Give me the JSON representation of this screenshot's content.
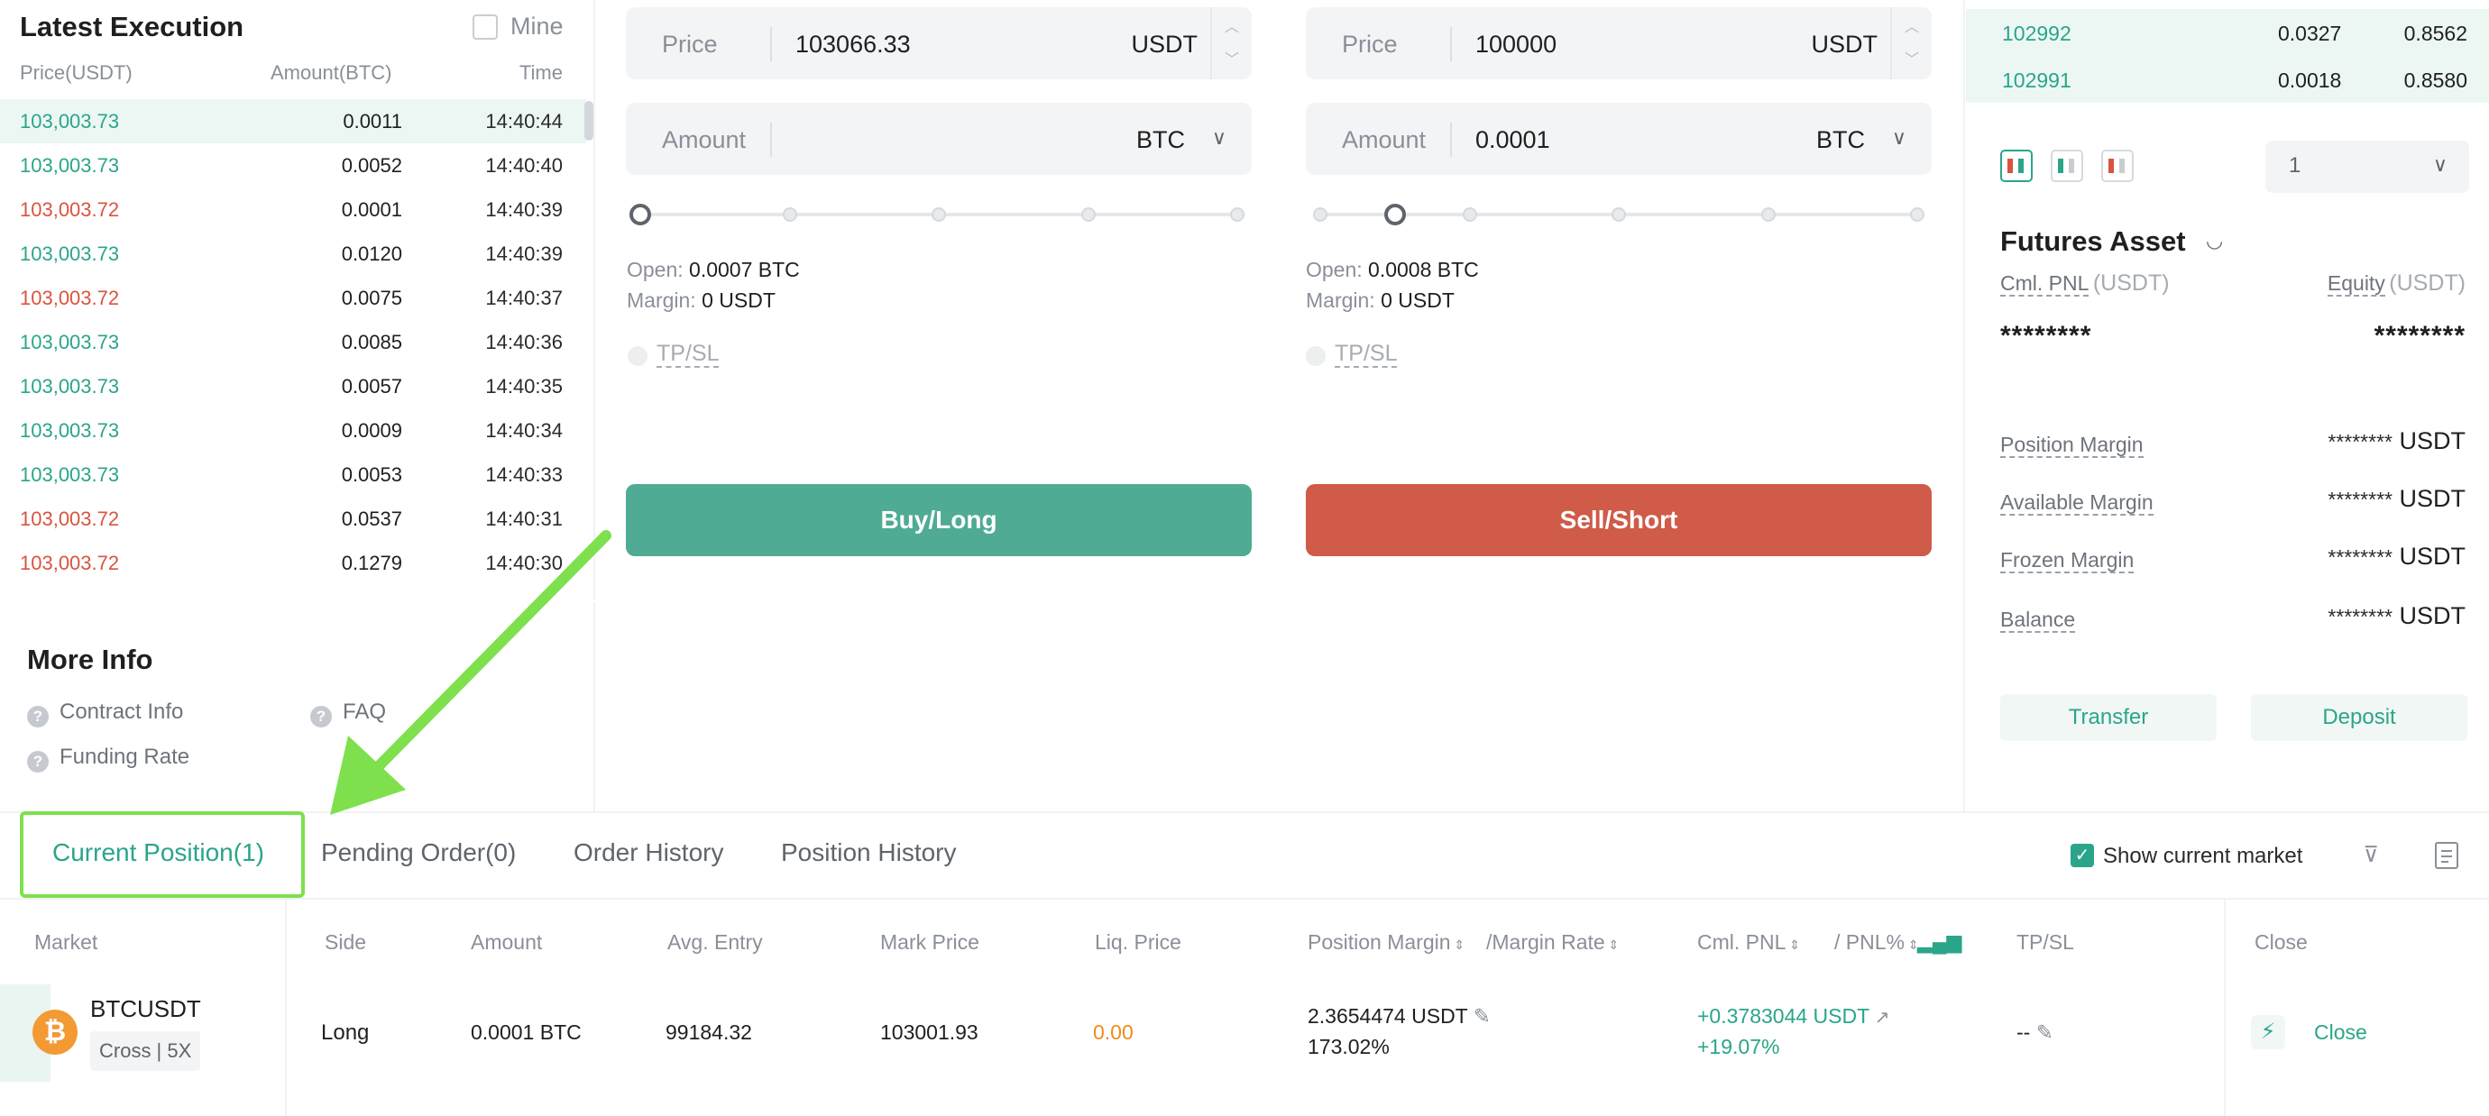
{
  "latest_execution": {
    "title": "Latest Execution",
    "mine_label": "Mine",
    "columns": {
      "price": "Price(USDT)",
      "amount": "Amount(BTC)",
      "time": "Time"
    },
    "rows": [
      {
        "price": "103,003.73",
        "amount": "0.0011",
        "time": "14:40:44",
        "side": "buy"
      },
      {
        "price": "103,003.73",
        "amount": "0.0052",
        "time": "14:40:40",
        "side": "buy"
      },
      {
        "price": "103,003.72",
        "amount": "0.0001",
        "time": "14:40:39",
        "side": "sell"
      },
      {
        "price": "103,003.73",
        "amount": "0.0120",
        "time": "14:40:39",
        "side": "buy"
      },
      {
        "price": "103,003.72",
        "amount": "0.0075",
        "time": "14:40:37",
        "side": "sell"
      },
      {
        "price": "103,003.73",
        "amount": "0.0085",
        "time": "14:40:36",
        "side": "buy"
      },
      {
        "price": "103,003.73",
        "amount": "0.0057",
        "time": "14:40:35",
        "side": "buy"
      },
      {
        "price": "103,003.73",
        "amount": "0.0009",
        "time": "14:40:34",
        "side": "buy"
      },
      {
        "price": "103,003.73",
        "amount": "0.0053",
        "time": "14:40:33",
        "side": "buy"
      },
      {
        "price": "103,003.72",
        "amount": "0.0537",
        "time": "14:40:31",
        "side": "sell"
      },
      {
        "price": "103,003.72",
        "amount": "0.1279",
        "time": "14:40:30",
        "side": "sell"
      }
    ]
  },
  "more_info": {
    "title": "More Info",
    "contract_info": "Contract Info",
    "faq": "FAQ",
    "funding_rate": "Funding Rate"
  },
  "buy_form": {
    "price_label": "Price",
    "price_value": "103066.33",
    "price_unit": "USDT",
    "amount_label": "Amount",
    "amount_value": "",
    "amount_unit": "BTC",
    "open_label": "Open:",
    "open_value": "0.0007 BTC",
    "margin_label": "Margin:",
    "margin_value": "0 USDT",
    "tpsl_label": "TP/SL",
    "button_label": "Buy/Long",
    "slider_level": 0
  },
  "sell_form": {
    "price_label": "Price",
    "price_value": "100000",
    "price_unit": "USDT",
    "amount_label": "Amount",
    "amount_value": "0.0001",
    "amount_unit": "BTC",
    "open_label": "Open:",
    "open_value": "0.0008 BTC",
    "margin_label": "Margin:",
    "margin_value": "0 USDT",
    "tpsl_label": "TP/SL",
    "button_label": "Sell/Short",
    "slider_level": 0.125
  },
  "order_book": {
    "rows": [
      {
        "price": "102992",
        "amount": "0.0327",
        "total": "0.8562"
      },
      {
        "price": "102991",
        "amount": "0.0018",
        "total": "0.8580"
      }
    ],
    "depth_value": "1"
  },
  "futures_asset": {
    "title": "Futures Asset",
    "cml_pnl_label": "Cml. PNL",
    "cml_pnl_unit": "(USDT)",
    "equity_label": "Equity",
    "equity_unit": "(USDT)",
    "cml_pnl_value": "********",
    "equity_value": "********",
    "rows": [
      {
        "label": "Position Margin",
        "value": "********",
        "unit": "USDT"
      },
      {
        "label": "Available Margin",
        "value": "********",
        "unit": "USDT"
      },
      {
        "label": "Frozen Margin",
        "value": "********",
        "unit": "USDT"
      },
      {
        "label": "Balance",
        "value": "********",
        "unit": "USDT"
      }
    ],
    "transfer_label": "Transfer",
    "deposit_label": "Deposit"
  },
  "tabs": {
    "current_position": "Current Position(1)",
    "pending_order": "Pending Order(0)",
    "order_history": "Order History",
    "position_history": "Position History",
    "show_current_market": "Show current market"
  },
  "positions": {
    "headers": {
      "market": "Market",
      "side": "Side",
      "amount": "Amount",
      "avg_entry": "Avg. Entry",
      "mark_price": "Mark Price",
      "liq_price": "Liq. Price",
      "position_margin": "Position Margin",
      "margin_rate": "/Margin Rate",
      "cml_pnl": "Cml. PNL",
      "pnl_pct": "/ PNL%",
      "tpsl": "TP/SL",
      "close": "Close"
    },
    "row": {
      "market": "BTCUSDT",
      "mode": "Cross | 5X",
      "coin_symbol": "₿",
      "side": "Long",
      "amount": "0.0001 BTC",
      "avg_entry": "99184.32",
      "mark_price": "103001.93",
      "liq_price": "0.00",
      "position_margin": "2.3654474 USDT",
      "margin_rate": "173.02%",
      "cml_pnl": "+0.3783044 USDT",
      "pnl_pct": "+19.07%",
      "tpsl": "--",
      "close_label": "Close"
    }
  },
  "colors": {
    "green": "#2aa58a",
    "red": "#d9543f",
    "annotation": "#7ee04d"
  }
}
